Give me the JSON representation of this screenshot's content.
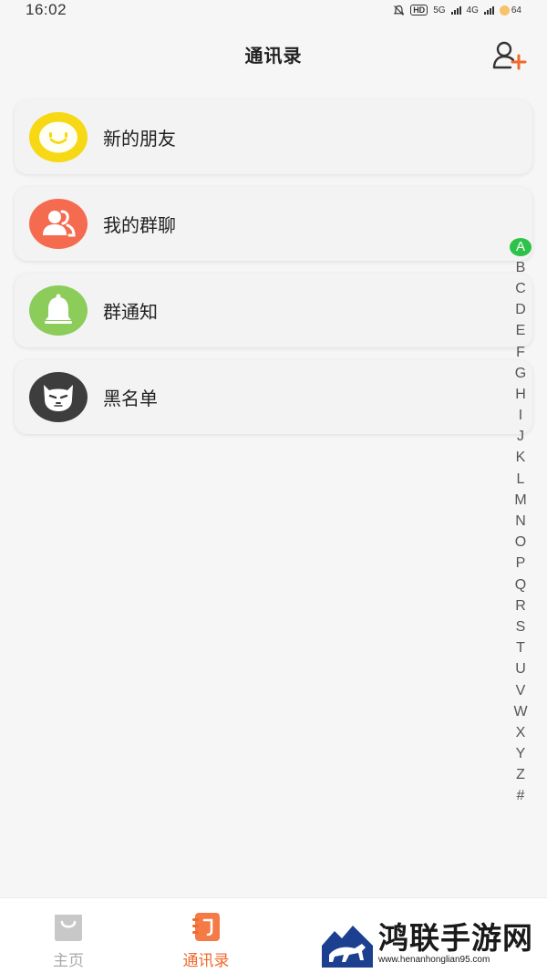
{
  "status_bar": {
    "time": "16:02",
    "hd_label": "HD",
    "net1": "5G",
    "net2": "4G",
    "battery": "64"
  },
  "header": {
    "title": "通讯录",
    "add_icon": "add-contact-icon"
  },
  "menu": [
    {
      "label": "新的朋友",
      "icon": "smile-face-icon",
      "color": "#f7d814"
    },
    {
      "label": "我的群聊",
      "icon": "group-users-icon",
      "color": "#f56b4f"
    },
    {
      "label": "群通知",
      "icon": "bell-icon",
      "color": "#8ccc5a"
    },
    {
      "label": "黑名单",
      "icon": "cat-face-icon",
      "color": "#3d3d3d"
    }
  ],
  "index_letters": [
    "A",
    "B",
    "C",
    "D",
    "E",
    "F",
    "G",
    "H",
    "I",
    "J",
    "K",
    "L",
    "M",
    "N",
    "O",
    "P",
    "Q",
    "R",
    "S",
    "T",
    "U",
    "V",
    "W",
    "X",
    "Y",
    "Z",
    "#"
  ],
  "index_active": "A",
  "tabs": [
    {
      "label": "主页",
      "icon": "shopping-bag-icon"
    },
    {
      "label": "通讯录",
      "icon": "contacts-book-icon"
    }
  ],
  "watermark": {
    "title": "鸿联手游网",
    "url": "www.henanhonglian95.com"
  },
  "colors": {
    "accent": "#f06a2c",
    "active_index": "#2fc24a"
  }
}
